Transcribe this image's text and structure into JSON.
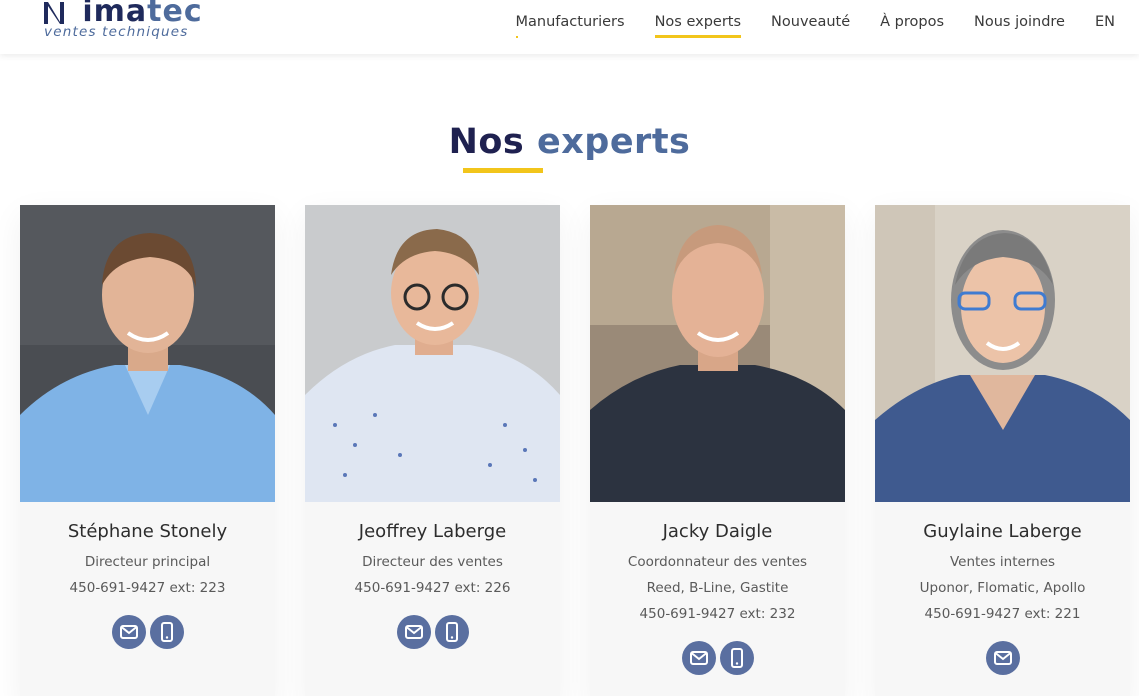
{
  "brand": {
    "logo_text_main": "nima",
    "logo_text_accent": "tec",
    "logo_tagline": "ventes techniques",
    "colors": {
      "navy": "#1f2150",
      "steel": "#4e6b9c",
      "accent": "#f2c51b",
      "icon_bg": "#5a6fa0"
    }
  },
  "nav": {
    "items": [
      {
        "label": "Manufacturiers"
      },
      {
        "label": "Nos experts"
      },
      {
        "label": "Nouveauté"
      },
      {
        "label": "À propos"
      },
      {
        "label": "Nous joindre"
      },
      {
        "label": "EN"
      }
    ],
    "active_index": 1
  },
  "section": {
    "title_part1": "Nos",
    "title_part2": "experts"
  },
  "experts": [
    {
      "name": "Stéphane Stonely",
      "lines": [
        "Directeur principal",
        "450-691-9427 ext: 223"
      ],
      "icons": [
        "envelope-icon",
        "mobile-phone-icon"
      ]
    },
    {
      "name": "Jeoffrey Laberge",
      "lines": [
        "Directeur des ventes",
        "450-691-9427 ext: 226"
      ],
      "icons": [
        "envelope-icon",
        "mobile-phone-icon"
      ]
    },
    {
      "name": "Jacky Daigle",
      "lines": [
        "Coordonnateur des ventes",
        "Reed, B-Line, Gastite",
        "450-691-9427 ext: 232"
      ],
      "icons": [
        "envelope-icon",
        "mobile-phone-icon"
      ]
    },
    {
      "name": "Guylaine Laberge",
      "lines": [
        "Ventes internes",
        "Uponor, Flomatic, Apollo",
        "450-691-9427 ext: 221"
      ],
      "icons": [
        "envelope-icon"
      ]
    }
  ]
}
